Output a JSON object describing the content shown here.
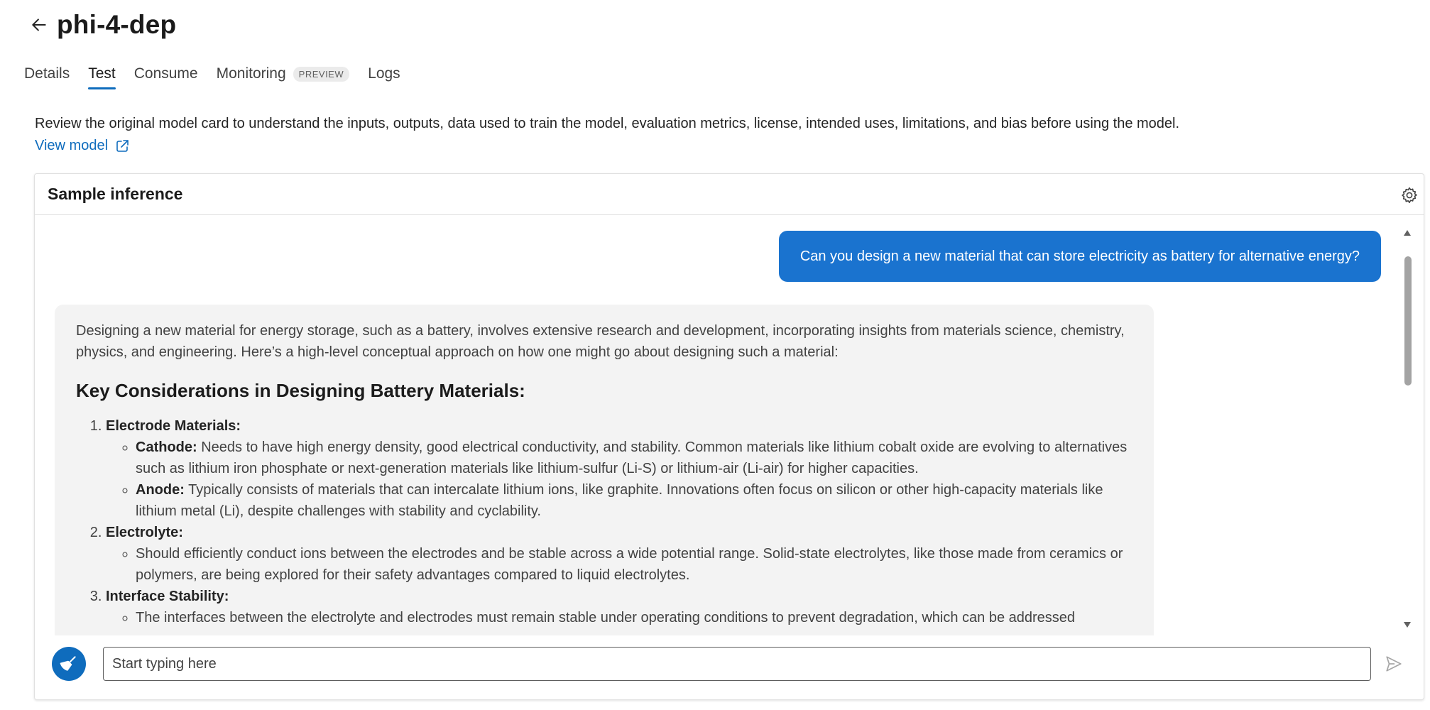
{
  "header": {
    "title": "phi-4-dep",
    "back_icon": "arrow-left-icon"
  },
  "tabs": [
    {
      "label": "Details",
      "active": false
    },
    {
      "label": "Test",
      "active": true
    },
    {
      "label": "Consume",
      "active": false
    },
    {
      "label": "Monitoring",
      "active": false,
      "badge": "PREVIEW"
    },
    {
      "label": "Logs",
      "active": false
    }
  ],
  "notice": {
    "text": "Review the original model card to understand the inputs, outputs, data used to train the model, evaluation metrics, license, intended uses, limitations, and bias before using the model.",
    "link_label": "View model",
    "link_icon": "open-external-icon"
  },
  "card": {
    "title": "Sample inference",
    "settings_icon": "gear-icon"
  },
  "chat": {
    "user_message": "Can you design a new material that can store electricity as battery for alternative energy?",
    "response": {
      "intro": "Designing a new material for energy storage, such as a battery, involves extensive research and development, incorporating insights from materials science, chemistry, physics, and engineering. Here’s a high-level conceptual approach on how one might go about designing such a material:",
      "heading": "Key Considerations in Designing Battery Materials:",
      "items": [
        {
          "title": "Electrode Materials:",
          "sub": [
            {
              "label": "Cathode:",
              "text": " Needs to have high energy density, good electrical conductivity, and stability. Common materials like lithium cobalt oxide are evolving to alternatives such as lithium iron phosphate or next-generation materials like lithium-sulfur (Li-S) or lithium-air (Li-air) for higher capacities."
            },
            {
              "label": "Anode:",
              "text": " Typically consists of materials that can intercalate lithium ions, like graphite. Innovations often focus on silicon or other high-capacity materials like lithium metal (Li), despite challenges with stability and cyclability."
            }
          ]
        },
        {
          "title": "Electrolyte:",
          "sub": [
            {
              "label": "",
              "text": "Should efficiently conduct ions between the electrodes and be stable across a wide potential range. Solid-state electrolytes, like those made from ceramics or polymers, are being explored for their safety advantages compared to liquid electrolytes."
            }
          ]
        },
        {
          "title": "Interface Stability:",
          "sub": [
            {
              "label": "",
              "text": "The interfaces between the electrolyte and electrodes must remain stable under operating conditions to prevent degradation, which can be addressed"
            }
          ]
        }
      ]
    }
  },
  "input": {
    "placeholder": "Start typing here",
    "value": "",
    "clear_icon": "broom-icon",
    "send_icon": "send-icon"
  },
  "colors": {
    "accent": "#0f6cbd",
    "user_bubble": "#1a73cf",
    "bot_bubble": "#f3f3f3"
  }
}
